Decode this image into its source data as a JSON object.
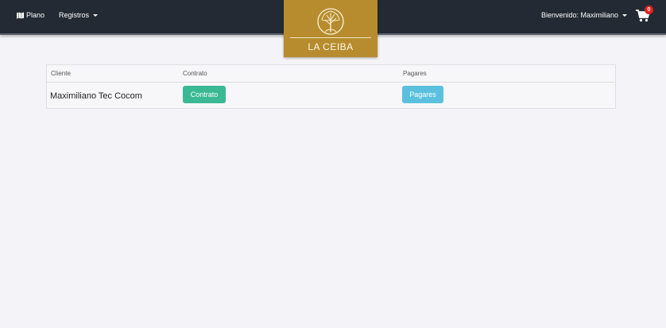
{
  "navbar": {
    "plano_label": "Plano",
    "registros_label": "Registros",
    "user_label": "Bienvenido: Maximiliano",
    "cart_count": "0",
    "background": "#232a33"
  },
  "logo": {
    "text": "LA CEIBA",
    "background": "#b68c2e"
  },
  "table": {
    "headers": [
      "Cliente",
      "Contrato",
      "Pagares"
    ],
    "rows": [
      {
        "cliente": "Maximiliano Tec Cocom",
        "contrato_button": "Contrato",
        "pagares_button": "Pagares"
      }
    ]
  },
  "colors": {
    "contrato_button": "#3bb894",
    "pagares_button": "#5bc0de",
    "cart_badge": "#e3211c"
  },
  "icons": [
    "map-icon",
    "shopping-cart-icon",
    "tree-logo-icon"
  ]
}
